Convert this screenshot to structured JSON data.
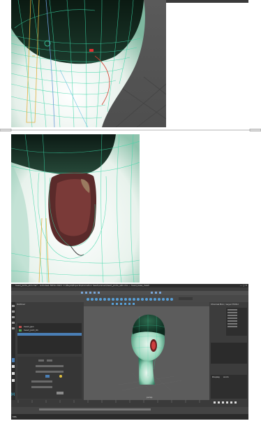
{
  "app_window": {
    "title": "head_joints_skin.ma* - Autodesk MAYA 2022: C:\\Maya\\Projects\\Animation head\\scenes\\head_joints_skin.ma  ---  head_base_mesh",
    "viewport_label": "persp",
    "outliner_title": "Outliner",
    "channel_box_title": "Channel Box / Layer Editor",
    "layer_tabs": [
      "Display",
      "Anim"
    ],
    "attribute_items": [
      "head_geo",
      "head_joint_01"
    ],
    "status_line": "MEL"
  },
  "colors": {
    "app_bg": "#444444",
    "viewport_bg": "#5c5c5c",
    "wireframe": "#37c9a0",
    "skin": "#f2f2f2",
    "mouth_interior": "#6b3535",
    "selection_blue": "#4a7fb6"
  }
}
